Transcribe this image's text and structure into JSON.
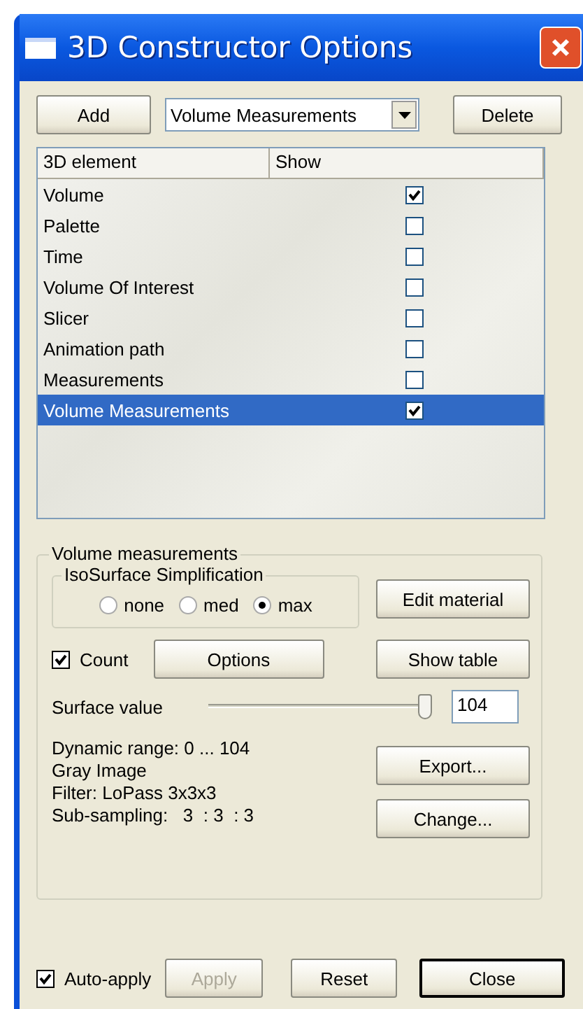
{
  "window": {
    "title": "3D Constructor Options"
  },
  "toolbar": {
    "add_button": "Add",
    "element_select": "Volume Measurements",
    "delete_button": "Delete"
  },
  "table": {
    "columns": [
      "3D element",
      "Show"
    ],
    "rows": [
      {
        "element": "Volume",
        "show": true,
        "selected": false
      },
      {
        "element": "Palette",
        "show": false,
        "selected": false
      },
      {
        "element": "Time",
        "show": false,
        "selected": false
      },
      {
        "element": "Volume Of Interest",
        "show": false,
        "selected": false
      },
      {
        "element": "Slicer",
        "show": false,
        "selected": false
      },
      {
        "element": "Animation path",
        "show": false,
        "selected": false
      },
      {
        "element": "Measurements",
        "show": false,
        "selected": false
      },
      {
        "element": "Volume Measurements",
        "show": true,
        "selected": true
      }
    ]
  },
  "volume_measurements": {
    "title": "Volume measurements",
    "simplification": {
      "title": "IsoSurface Simplification",
      "options": [
        {
          "label": "none",
          "selected": false
        },
        {
          "label": "med",
          "selected": false
        },
        {
          "label": "max",
          "selected": true
        }
      ]
    },
    "edit_material_button": "Edit material",
    "count": {
      "label": "Count",
      "checked": true
    },
    "options_button": "Options",
    "show_table_button": "Show table",
    "surface_value": {
      "label": "Surface value",
      "level": 1.0,
      "value": "104"
    },
    "info_lines": [
      "Dynamic range: 0 ... 104",
      "Gray Image",
      "Filter: LoPass 3x3x3",
      "Sub-sampling:   3  : 3  : 3"
    ],
    "export_button": "Export...",
    "change_button": "Change..."
  },
  "footer": {
    "auto_apply": {
      "label": "Auto-apply",
      "checked": true
    },
    "apply_button": {
      "label": "Apply",
      "disabled": true
    },
    "reset_button": "Reset",
    "close_button": "Close"
  }
}
